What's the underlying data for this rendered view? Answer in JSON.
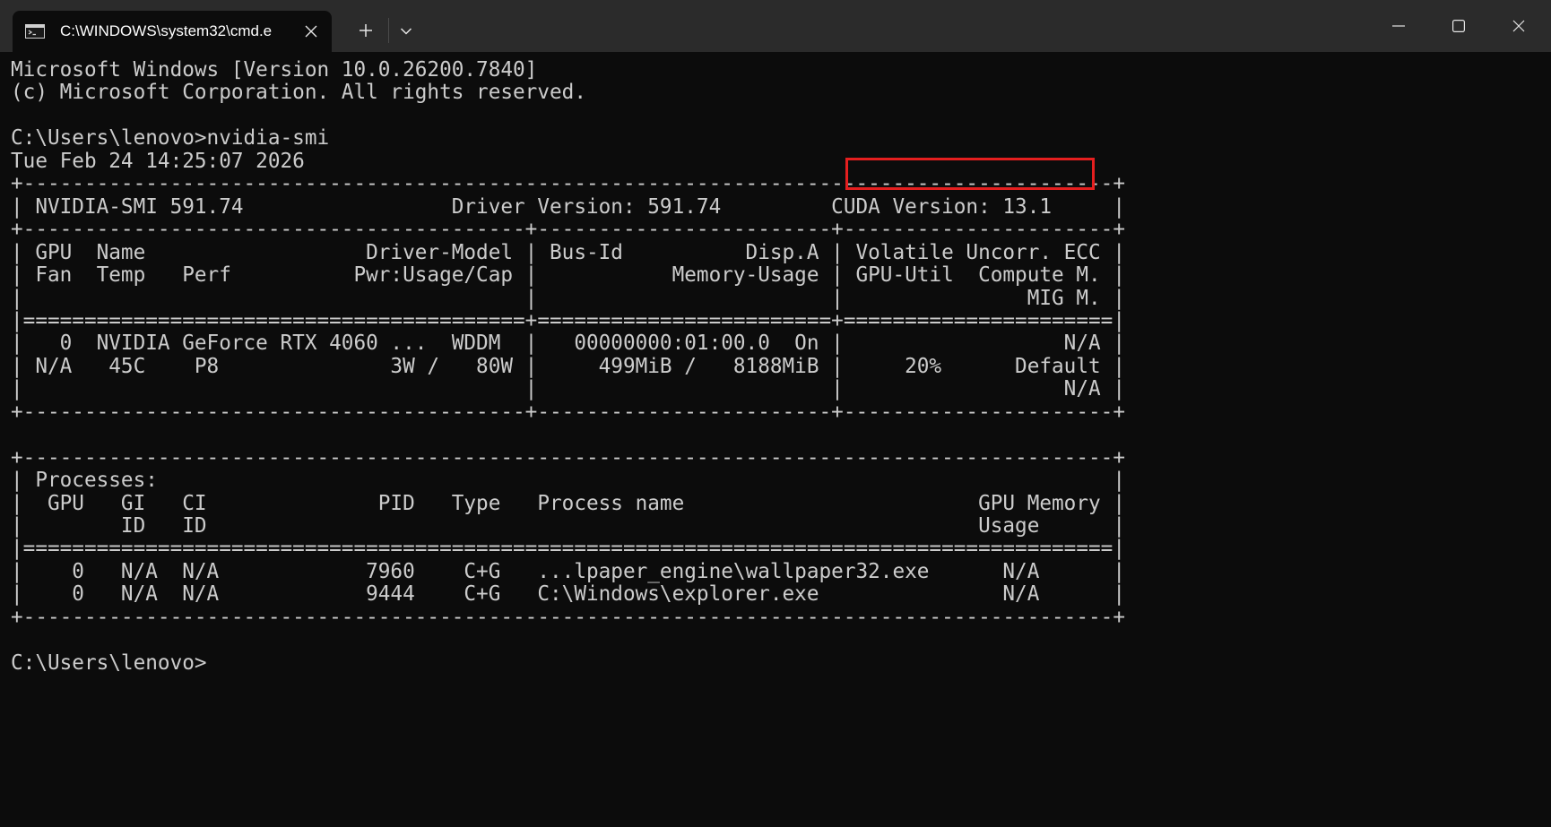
{
  "titlebar": {
    "tab_title": "C:\\WINDOWS\\system32\\cmd.e",
    "tab_icon": "terminal-icon",
    "tab_close_icon": "close-icon",
    "new_tab_icon": "plus-icon",
    "tab_menu_icon": "chevron-down-icon",
    "minimize_icon": "minimize-icon",
    "maximize_icon": "maximize-icon",
    "close_icon": "close-icon"
  },
  "colors": {
    "background": "#0c0c0c",
    "text": "#cccccc",
    "titlebar": "#2b2b2b",
    "highlight": "#e51f1f"
  },
  "console": {
    "lines": [
      "Microsoft Windows [Version 10.0.26200.7840]",
      "(c) Microsoft Corporation. All rights reserved.",
      "",
      "C:\\Users\\lenovo>nvidia-smi",
      "Tue Feb 24 14:25:07 2026",
      "+-----------------------------------------------------------------------------------------+",
      "| NVIDIA-SMI 591.74                 Driver Version: 591.74         CUDA Version: 13.1     |",
      "+-----------------------------------------+------------------------+----------------------+",
      "| GPU  Name                  Driver-Model | Bus-Id          Disp.A | Volatile Uncorr. ECC |",
      "| Fan  Temp   Perf          Pwr:Usage/Cap |           Memory-Usage | GPU-Util  Compute M. |",
      "|                                         |                        |               MIG M. |",
      "|=========================================+========================+======================|",
      "|   0  NVIDIA GeForce RTX 4060 ...  WDDM  |   00000000:01:00.0  On |                  N/A |",
      "| N/A   45C    P8              3W /   80W |     499MiB /   8188MiB |     20%      Default |",
      "|                                         |                        |                  N/A |",
      "+-----------------------------------------+------------------------+----------------------+",
      "",
      "+-----------------------------------------------------------------------------------------+",
      "| Processes:                                                                              |",
      "|  GPU   GI   CI              PID   Type   Process name                        GPU Memory |",
      "|        ID   ID                                                               Usage      |",
      "|=========================================================================================|",
      "|    0   N/A  N/A            7960    C+G   ...lpaper_engine\\wallpaper32.exe      N/A      |",
      "|    0   N/A  N/A            9444    C+G   C:\\Windows\\explorer.exe               N/A      |",
      "+-----------------------------------------------------------------------------------------+",
      "",
      "C:\\Users\\lenovo>"
    ]
  }
}
